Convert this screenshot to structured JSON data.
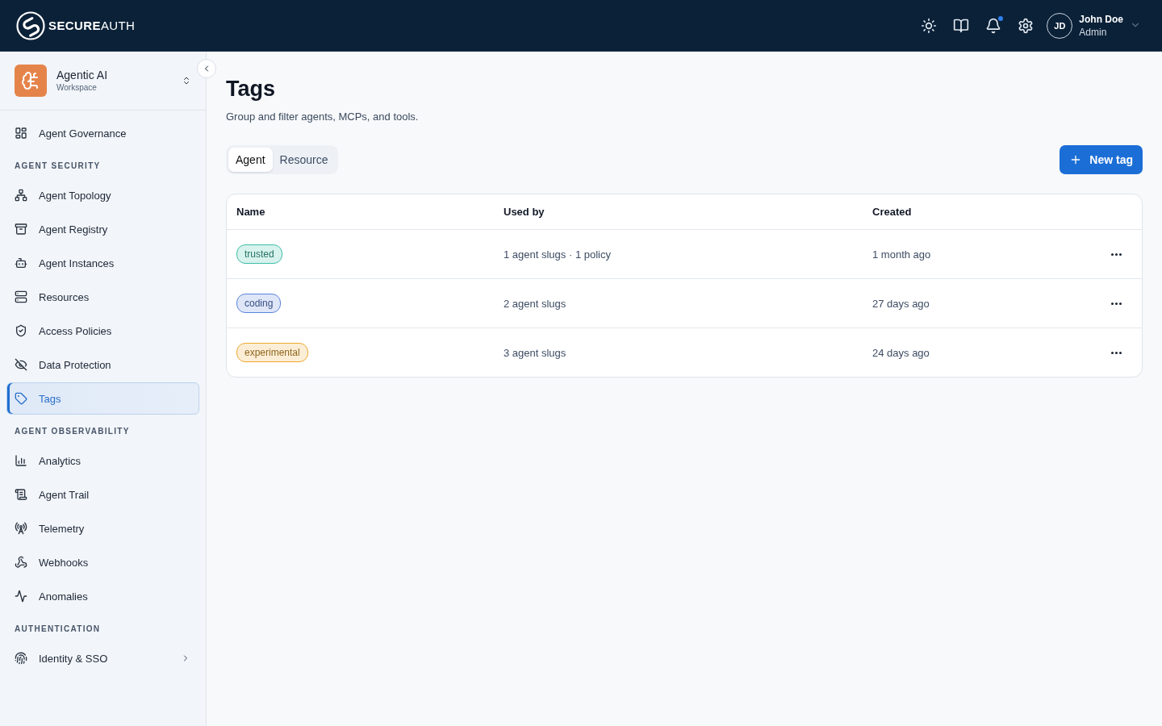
{
  "header": {
    "brand": "**SECURE**AUTH",
    "notifications": {
      "unread": true
    },
    "user": {
      "initials": "JD",
      "name": "John Doe",
      "role": "Admin"
    }
  },
  "sidebar": {
    "workspace": {
      "name": "Agentic AI",
      "subtitle": "Workspace"
    },
    "sections": [
      {
        "items": [
          {
            "label": "Agent Governance",
            "kind": "link",
            "selected": false
          }
        ]
      },
      {
        "title": "AGENT SECURITY",
        "items": [
          {
            "label": "Agent Topology",
            "kind": "link",
            "selected": false
          },
          {
            "label": "Agent Registry",
            "kind": "link",
            "selected": false
          },
          {
            "label": "Agent Instances",
            "kind": "link",
            "selected": false
          },
          {
            "label": "Resources",
            "kind": "link",
            "selected": false
          },
          {
            "label": "Access Policies",
            "kind": "link",
            "selected": false
          },
          {
            "label": "Data Protection",
            "kind": "link",
            "selected": false
          },
          {
            "label": "Tags",
            "kind": "link",
            "selected": true
          }
        ]
      },
      {
        "title": "AGENT OBSERVABILITY",
        "items": [
          {
            "label": "Analytics",
            "kind": "link",
            "selected": false
          },
          {
            "label": "Agent Trail",
            "kind": "link",
            "selected": false
          },
          {
            "label": "Telemetry",
            "kind": "link",
            "selected": false
          },
          {
            "label": "Webhooks",
            "kind": "link",
            "selected": false
          },
          {
            "label": "Anomalies",
            "kind": "link",
            "selected": false
          }
        ]
      },
      {
        "title": "AUTHENTICATION",
        "items": [
          {
            "label": "Identity & SSO",
            "kind": "group",
            "expanded": false,
            "selected": false
          }
        ]
      }
    ]
  },
  "page": {
    "title": "Tags",
    "subtitle": "Group and filter agents, MCPs, and tools.",
    "tabs": [
      {
        "label": "Agent",
        "selected": true
      },
      {
        "label": "Resource",
        "selected": false
      }
    ],
    "new_button": "New tag"
  },
  "table": {
    "columns": [
      "Name",
      "Used by",
      "Created"
    ],
    "rows": [
      {
        "tag": {
          "label": "trusted",
          "color": "#3cbfa7"
        },
        "used_by": "1 agent slugs · 1 policy",
        "created": "1 month ago"
      },
      {
        "tag": {
          "label": "coding",
          "color": "#5b84dd"
        },
        "used_by": "2 agent slugs",
        "created": "27 days ago"
      },
      {
        "tag": {
          "label": "experimental",
          "color": "#f0a830"
        },
        "used_by": "3 agent slugs",
        "created": "24 days ago"
      }
    ]
  }
}
